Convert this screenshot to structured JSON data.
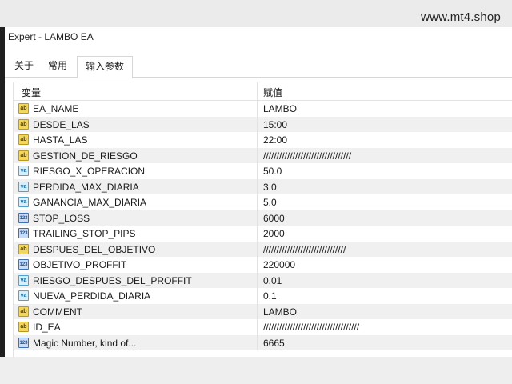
{
  "window": {
    "title": "Expert - LAMBO EA"
  },
  "watermark": "www.mt4.shop",
  "tabs": [
    {
      "label": "关于",
      "active": false
    },
    {
      "label": "常用",
      "active": false
    },
    {
      "label": "输入参数",
      "active": true
    }
  ],
  "table": {
    "headers": {
      "name": "变量",
      "value": "赋值"
    },
    "rows": [
      {
        "icon": "ab",
        "name": "EA_NAME",
        "value": "LAMBO"
      },
      {
        "icon": "ab",
        "name": "DESDE_LAS",
        "value": "15:00"
      },
      {
        "icon": "ab",
        "name": "HASTA_LAS",
        "value": "22:00"
      },
      {
        "icon": "ab",
        "name": "GESTION_DE_RIESGO",
        "value": "/////////////////////////////////"
      },
      {
        "icon": "va",
        "name": "RIESGO_X_OPERACION",
        "value": "50.0"
      },
      {
        "icon": "va",
        "name": "PERDIDA_MAX_DIARIA",
        "value": "3.0"
      },
      {
        "icon": "va",
        "name": "GANANCIA_MAX_DIARIA",
        "value": "5.0"
      },
      {
        "icon": "123",
        "name": "STOP_LOSS",
        "value": "6000"
      },
      {
        "icon": "123",
        "name": "TRAILING_STOP_PIPS",
        "value": "2000"
      },
      {
        "icon": "ab",
        "name": "DESPUES_DEL_OBJETIVO",
        "value": "///////////////////////////////"
      },
      {
        "icon": "123",
        "name": "OBJETIVO_PROFFIT",
        "value": "220000"
      },
      {
        "icon": "va",
        "name": "RIESGO_DESPUES_DEL_PROFFIT",
        "value": "0.01"
      },
      {
        "icon": "va",
        "name": "NUEVA_PERDIDA_DIARIA",
        "value": "0.1"
      },
      {
        "icon": "ab",
        "name": "COMMENT",
        "value": "LAMBO"
      },
      {
        "icon": "ab",
        "name": "ID_EA",
        "value": "////////////////////////////////////"
      },
      {
        "icon": "123",
        "name": "Magic Number, kind of...",
        "value": "6665"
      }
    ]
  },
  "icon_types": {
    "ab": "string-param-icon",
    "va": "double-param-icon",
    "123": "integer-param-icon"
  },
  "colors": {
    "row_alt": "#f0f0f0",
    "grid_line": "#e2e2e2"
  }
}
